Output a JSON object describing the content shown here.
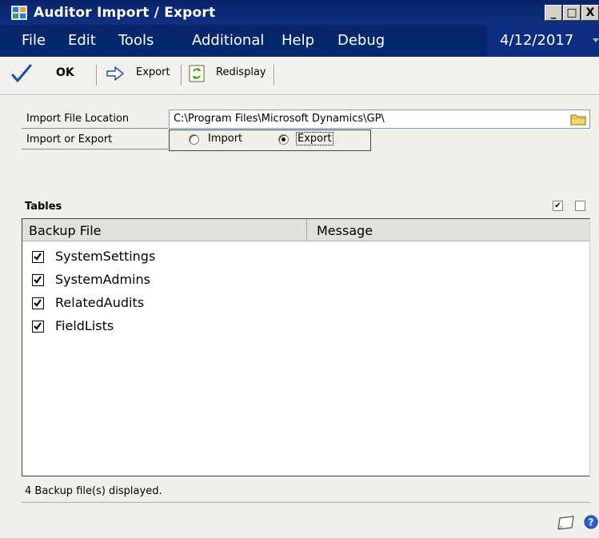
{
  "window": {
    "title": "Auditor Import / Export",
    "controls": {
      "minimize": "_",
      "maximize": "□",
      "close": "X"
    }
  },
  "menu": {
    "items": [
      "File",
      "Edit",
      "Tools",
      "Additional",
      "Help",
      "Debug"
    ],
    "date": "4/12/2017"
  },
  "toolbar": {
    "ok_label": "OK",
    "export_label": "Export",
    "redisplay_label": "Redisplay"
  },
  "form": {
    "import_file_location_label": "Import File Location",
    "import_file_location_value": "C:\\Program Files\\Microsoft Dynamics\\GP\\",
    "import_or_export_label": "Import or Export",
    "options": [
      {
        "label": "Import",
        "selected": false
      },
      {
        "label": "Export",
        "selected": true
      }
    ]
  },
  "tables": {
    "title": "Tables",
    "columns": [
      "Backup File",
      "Message"
    ],
    "rows": [
      {
        "name": "SystemSettings",
        "checked": true,
        "message": ""
      },
      {
        "name": "SystemAdmins",
        "checked": true,
        "message": ""
      },
      {
        "name": "RelatedAudits",
        "checked": true,
        "message": ""
      },
      {
        "name": "FieldLists",
        "checked": true,
        "message": ""
      }
    ],
    "select_all_mark": "✔"
  },
  "status": {
    "text": "4 Backup file(s) displayed."
  },
  "colors": {
    "titlebar": "#0a246a",
    "panel": "#f0efe9",
    "accent": "#1a5fc8"
  },
  "icons": [
    "app-icon",
    "checkmark-icon",
    "arrow-right-icon",
    "refresh-icon",
    "folder-icon",
    "note-icon",
    "help-icon"
  ]
}
